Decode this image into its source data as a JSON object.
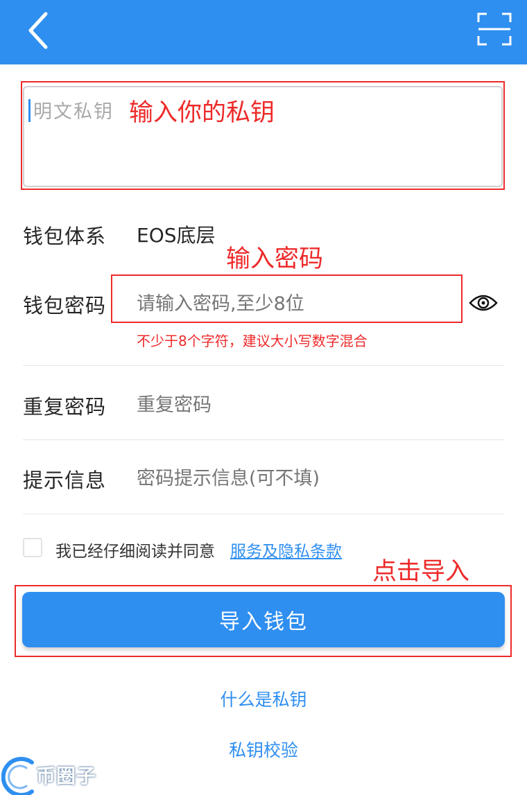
{
  "header": {
    "back_icon": "chevron-left-icon",
    "scan_icon": "scan-frame-icon",
    "bg_color": "#2f8ff0"
  },
  "private_key": {
    "placeholder": "明文私钥"
  },
  "annotations": {
    "key": "输入你的私钥",
    "password": "输入密码",
    "import": "点击导入"
  },
  "form": {
    "wallet_system_label": "钱包体系",
    "wallet_system_value": "EOS底层",
    "password_label": "钱包密码",
    "password_placeholder": "请输入密码,至少8位",
    "password_hint": "不少于8个字符，建议大小写数字混合",
    "repeat_label": "重复密码",
    "repeat_placeholder": "重复密码",
    "hint_label": "提示信息",
    "hint_placeholder": "密码提示信息(可不填)"
  },
  "agreement": {
    "text": "我已经仔细阅读并同意",
    "link": "服务及隐私条款",
    "checked": false
  },
  "import_button": "导入钱包",
  "links": {
    "what_is_key": "什么是私钥",
    "verify_key": "私钥校验"
  },
  "watermark": {
    "text": "币圈子"
  },
  "colors": {
    "accent": "#2f8ff0",
    "annotation": "#ee2a2a"
  }
}
